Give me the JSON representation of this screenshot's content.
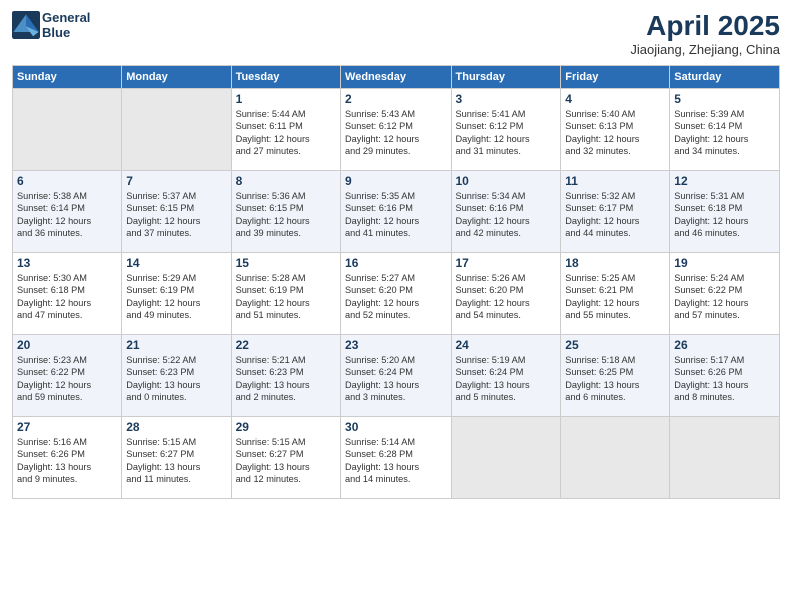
{
  "header": {
    "logo_line1": "General",
    "logo_line2": "Blue",
    "month": "April 2025",
    "location": "Jiaojiang, Zhejiang, China"
  },
  "days_of_week": [
    "Sunday",
    "Monday",
    "Tuesday",
    "Wednesday",
    "Thursday",
    "Friday",
    "Saturday"
  ],
  "weeks": [
    [
      {
        "day": "",
        "info": ""
      },
      {
        "day": "",
        "info": ""
      },
      {
        "day": "1",
        "info": "Sunrise: 5:44 AM\nSunset: 6:11 PM\nDaylight: 12 hours\nand 27 minutes."
      },
      {
        "day": "2",
        "info": "Sunrise: 5:43 AM\nSunset: 6:12 PM\nDaylight: 12 hours\nand 29 minutes."
      },
      {
        "day": "3",
        "info": "Sunrise: 5:41 AM\nSunset: 6:12 PM\nDaylight: 12 hours\nand 31 minutes."
      },
      {
        "day": "4",
        "info": "Sunrise: 5:40 AM\nSunset: 6:13 PM\nDaylight: 12 hours\nand 32 minutes."
      },
      {
        "day": "5",
        "info": "Sunrise: 5:39 AM\nSunset: 6:14 PM\nDaylight: 12 hours\nand 34 minutes."
      }
    ],
    [
      {
        "day": "6",
        "info": "Sunrise: 5:38 AM\nSunset: 6:14 PM\nDaylight: 12 hours\nand 36 minutes."
      },
      {
        "day": "7",
        "info": "Sunrise: 5:37 AM\nSunset: 6:15 PM\nDaylight: 12 hours\nand 37 minutes."
      },
      {
        "day": "8",
        "info": "Sunrise: 5:36 AM\nSunset: 6:15 PM\nDaylight: 12 hours\nand 39 minutes."
      },
      {
        "day": "9",
        "info": "Sunrise: 5:35 AM\nSunset: 6:16 PM\nDaylight: 12 hours\nand 41 minutes."
      },
      {
        "day": "10",
        "info": "Sunrise: 5:34 AM\nSunset: 6:16 PM\nDaylight: 12 hours\nand 42 minutes."
      },
      {
        "day": "11",
        "info": "Sunrise: 5:32 AM\nSunset: 6:17 PM\nDaylight: 12 hours\nand 44 minutes."
      },
      {
        "day": "12",
        "info": "Sunrise: 5:31 AM\nSunset: 6:18 PM\nDaylight: 12 hours\nand 46 minutes."
      }
    ],
    [
      {
        "day": "13",
        "info": "Sunrise: 5:30 AM\nSunset: 6:18 PM\nDaylight: 12 hours\nand 47 minutes."
      },
      {
        "day": "14",
        "info": "Sunrise: 5:29 AM\nSunset: 6:19 PM\nDaylight: 12 hours\nand 49 minutes."
      },
      {
        "day": "15",
        "info": "Sunrise: 5:28 AM\nSunset: 6:19 PM\nDaylight: 12 hours\nand 51 minutes."
      },
      {
        "day": "16",
        "info": "Sunrise: 5:27 AM\nSunset: 6:20 PM\nDaylight: 12 hours\nand 52 minutes."
      },
      {
        "day": "17",
        "info": "Sunrise: 5:26 AM\nSunset: 6:20 PM\nDaylight: 12 hours\nand 54 minutes."
      },
      {
        "day": "18",
        "info": "Sunrise: 5:25 AM\nSunset: 6:21 PM\nDaylight: 12 hours\nand 55 minutes."
      },
      {
        "day": "19",
        "info": "Sunrise: 5:24 AM\nSunset: 6:22 PM\nDaylight: 12 hours\nand 57 minutes."
      }
    ],
    [
      {
        "day": "20",
        "info": "Sunrise: 5:23 AM\nSunset: 6:22 PM\nDaylight: 12 hours\nand 59 minutes."
      },
      {
        "day": "21",
        "info": "Sunrise: 5:22 AM\nSunset: 6:23 PM\nDaylight: 13 hours\nand 0 minutes."
      },
      {
        "day": "22",
        "info": "Sunrise: 5:21 AM\nSunset: 6:23 PM\nDaylight: 13 hours\nand 2 minutes."
      },
      {
        "day": "23",
        "info": "Sunrise: 5:20 AM\nSunset: 6:24 PM\nDaylight: 13 hours\nand 3 minutes."
      },
      {
        "day": "24",
        "info": "Sunrise: 5:19 AM\nSunset: 6:24 PM\nDaylight: 13 hours\nand 5 minutes."
      },
      {
        "day": "25",
        "info": "Sunrise: 5:18 AM\nSunset: 6:25 PM\nDaylight: 13 hours\nand 6 minutes."
      },
      {
        "day": "26",
        "info": "Sunrise: 5:17 AM\nSunset: 6:26 PM\nDaylight: 13 hours\nand 8 minutes."
      }
    ],
    [
      {
        "day": "27",
        "info": "Sunrise: 5:16 AM\nSunset: 6:26 PM\nDaylight: 13 hours\nand 9 minutes."
      },
      {
        "day": "28",
        "info": "Sunrise: 5:15 AM\nSunset: 6:27 PM\nDaylight: 13 hours\nand 11 minutes."
      },
      {
        "day": "29",
        "info": "Sunrise: 5:15 AM\nSunset: 6:27 PM\nDaylight: 13 hours\nand 12 minutes."
      },
      {
        "day": "30",
        "info": "Sunrise: 5:14 AM\nSunset: 6:28 PM\nDaylight: 13 hours\nand 14 minutes."
      },
      {
        "day": "",
        "info": ""
      },
      {
        "day": "",
        "info": ""
      },
      {
        "day": "",
        "info": ""
      }
    ]
  ]
}
